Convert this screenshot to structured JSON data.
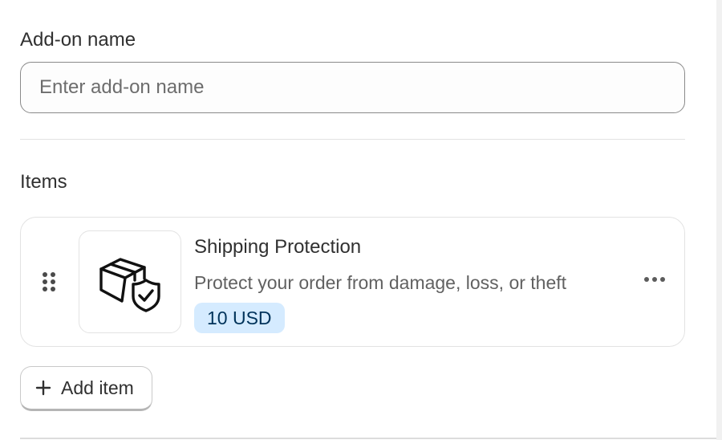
{
  "addon": {
    "name_label": "Add-on name",
    "name_value": "",
    "name_placeholder": "Enter add-on name"
  },
  "items_section": {
    "title": "Items",
    "items": [
      {
        "title": "Shipping Protection",
        "description": "Protect your order from damage, loss, or theft",
        "price": "10 USD",
        "icon": "package-shield-icon"
      }
    ],
    "add_item_label": "Add item"
  },
  "colors": {
    "badge_bg": "#d5ebff",
    "badge_text": "#00335a",
    "text_primary": "#303030",
    "text_secondary": "#616161",
    "border": "#e3e3e3"
  }
}
